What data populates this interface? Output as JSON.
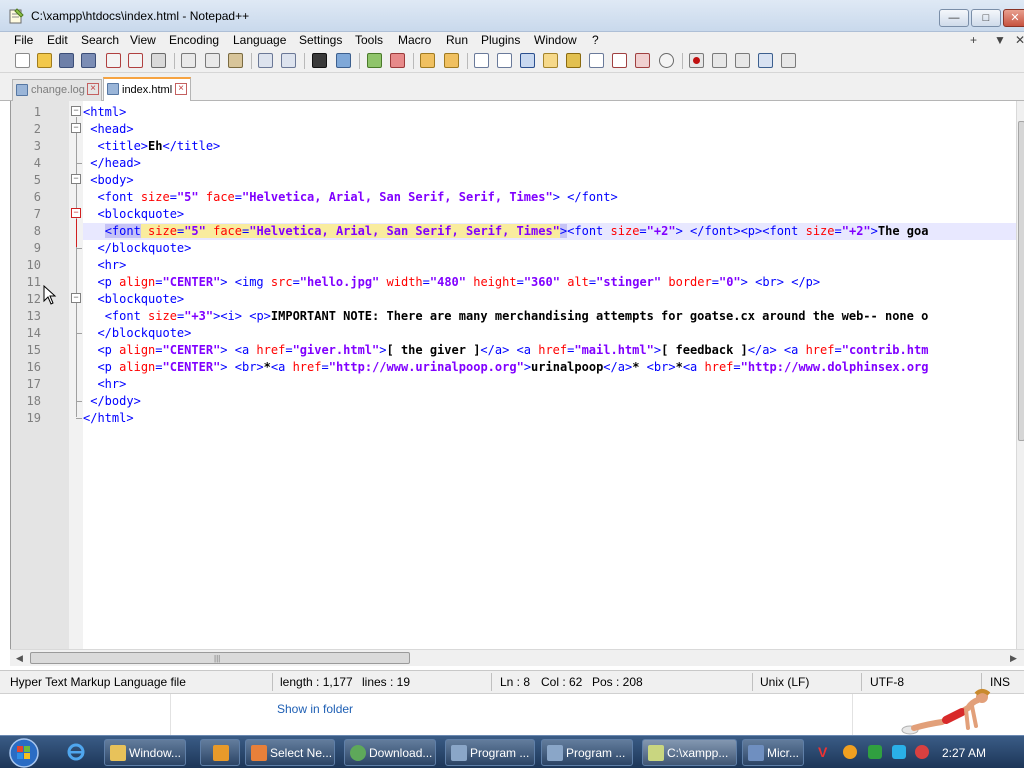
{
  "window": {
    "title": "C:\\xampp\\htdocs\\index.html - Notepad++",
    "minimize": "—",
    "maximize": "□",
    "close": "✕"
  },
  "menu": {
    "items": [
      "File",
      "Edit",
      "Search",
      "View",
      "Encoding",
      "Language",
      "Settings",
      "Tools",
      "Macro",
      "Run",
      "Plugins",
      "Window",
      "?"
    ],
    "right_items": [
      "+",
      "▼",
      "✕"
    ]
  },
  "tabs": [
    {
      "label": "change.log",
      "active": false
    },
    {
      "label": "index.html",
      "active": true
    }
  ],
  "editor": {
    "line_numbers": [
      "1",
      "2",
      "3",
      "4",
      "5",
      "6",
      "7",
      "8",
      "9",
      "10",
      "11",
      "12",
      "13",
      "14",
      "15",
      "16",
      "17",
      "18",
      "19"
    ],
    "current_line": 8
  },
  "status": {
    "file_type": "Hyper Text Markup Language file",
    "length": "length : 1,177",
    "lines": "lines : 19",
    "ln": "Ln : 8",
    "col": "Col : 62",
    "pos": "Pos : 208",
    "eol": "Unix (LF)",
    "encoding": "UTF-8",
    "mode": "INS"
  },
  "background_window": {
    "link": "Show in folder"
  },
  "taskbar": {
    "buttons": [
      {
        "label": "Window...",
        "icon": "folder-icon",
        "color": "#e8c25a"
      },
      {
        "label": "Select Ne...",
        "icon": "paint-icon",
        "color": "#e8803a"
      },
      {
        "label": "Download...",
        "icon": "chrome-icon",
        "color": "#5ea85a"
      },
      {
        "label": "Program ...",
        "icon": "program-window-icon",
        "color": "#8aa6c8"
      },
      {
        "label": "Program ...",
        "icon": "program-window-icon",
        "color": "#8aa6c8"
      },
      {
        "label": "C:\\xampp...",
        "icon": "notepad-icon",
        "color": "#c9d680"
      },
      {
        "label": "Micr...",
        "icon": "microsoft-icon",
        "color": "#6f8fc0"
      }
    ],
    "clock": "2:27 AM"
  }
}
